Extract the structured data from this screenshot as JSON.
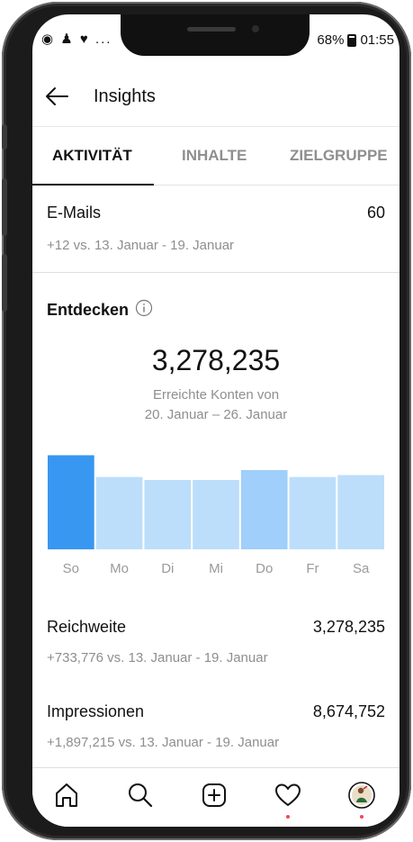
{
  "status_bar": {
    "left_icons": "◉ ♟ ♥ ...",
    "battery": "68%",
    "time": "01:55"
  },
  "header": {
    "title": "Insights"
  },
  "tabs": [
    {
      "label": "AKTIVITÄT",
      "active": true
    },
    {
      "label": "INHALTE",
      "active": false
    },
    {
      "label": "ZIELGRUPPE",
      "active": false
    }
  ],
  "emails": {
    "label": "E-Mails",
    "value": "60",
    "comparison": "+12 vs. 13. Januar - 19. Januar"
  },
  "discover": {
    "title": "Entdecken",
    "info_icon": "info-icon",
    "big_number": "3,278,235",
    "caption_line1": "Erreichte Konten von",
    "caption_line2": "20. Januar – 26. Januar"
  },
  "chart_data": {
    "type": "bar",
    "categories": [
      "So",
      "Mo",
      "Di",
      "Mi",
      "Do",
      "Fr",
      "Sa"
    ],
    "values": [
      95,
      73,
      70,
      70,
      80,
      73,
      75
    ],
    "ylim": [
      0,
      100
    ],
    "highlight_index": 0,
    "colors": {
      "highlight": "#3897f0",
      "secondary_highlight": "#9fcffa",
      "bar": "#bcdefb"
    },
    "secondary_highlight_index": 4
  },
  "reach": {
    "label": "Reichweite",
    "value": "3,278,235",
    "comparison": "+733,776 vs. 13. Januar - 19. Januar"
  },
  "impressions": {
    "label": "Impressionen",
    "value": "8,674,752",
    "comparison": "+1,897,215 vs. 13. Januar - 19. Januar"
  },
  "bottom_nav": [
    {
      "name": "home-icon"
    },
    {
      "name": "search-icon"
    },
    {
      "name": "new-post-icon"
    },
    {
      "name": "activity-heart-icon"
    },
    {
      "name": "profile-avatar"
    }
  ],
  "accent_color": "#ed4956"
}
